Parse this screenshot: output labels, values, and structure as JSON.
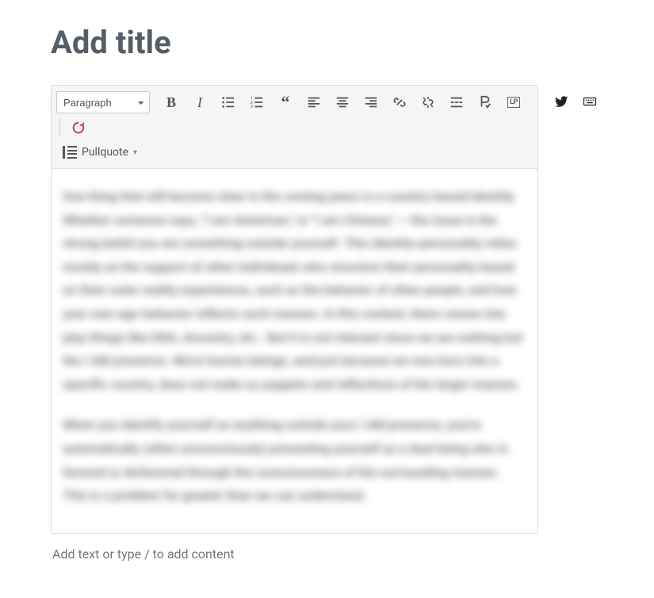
{
  "title": {
    "placeholder": "Add title",
    "value": ""
  },
  "toolbar": {
    "format_select": "Paragraph",
    "pullquote_label": "Pullquote"
  },
  "body": {
    "p1": "One thing that will become clear in the coming years is a country-based identity. Whether someone says, \"I am American,\" or \"I am Chinese,\" — the issue is the strong belief you are something outside yourself. This identity-personality relies mostly on the support of other individuals who structure their personality based on their outer reality experiences, such as the behavior of other people, and how your own ego-behavior reflects such masses. In this context, there comes into play things like DNA, Ancestry, etc.. But it is not relevant since we are nothing but the I AM presence. We're human beings, and just because we was born into a specific country, does not make us puppets and reflections of the larger masses.",
    "p2": "When you identify yourself as anything outside your I AM presence, you're automatically (often unconsciously) presenting yourself as a dual being who is favored or disfavored through the consciousness of the surrounding masses. This is a problem far greater than we can understand."
  },
  "footer_prompt": "Add text or type / to add content"
}
